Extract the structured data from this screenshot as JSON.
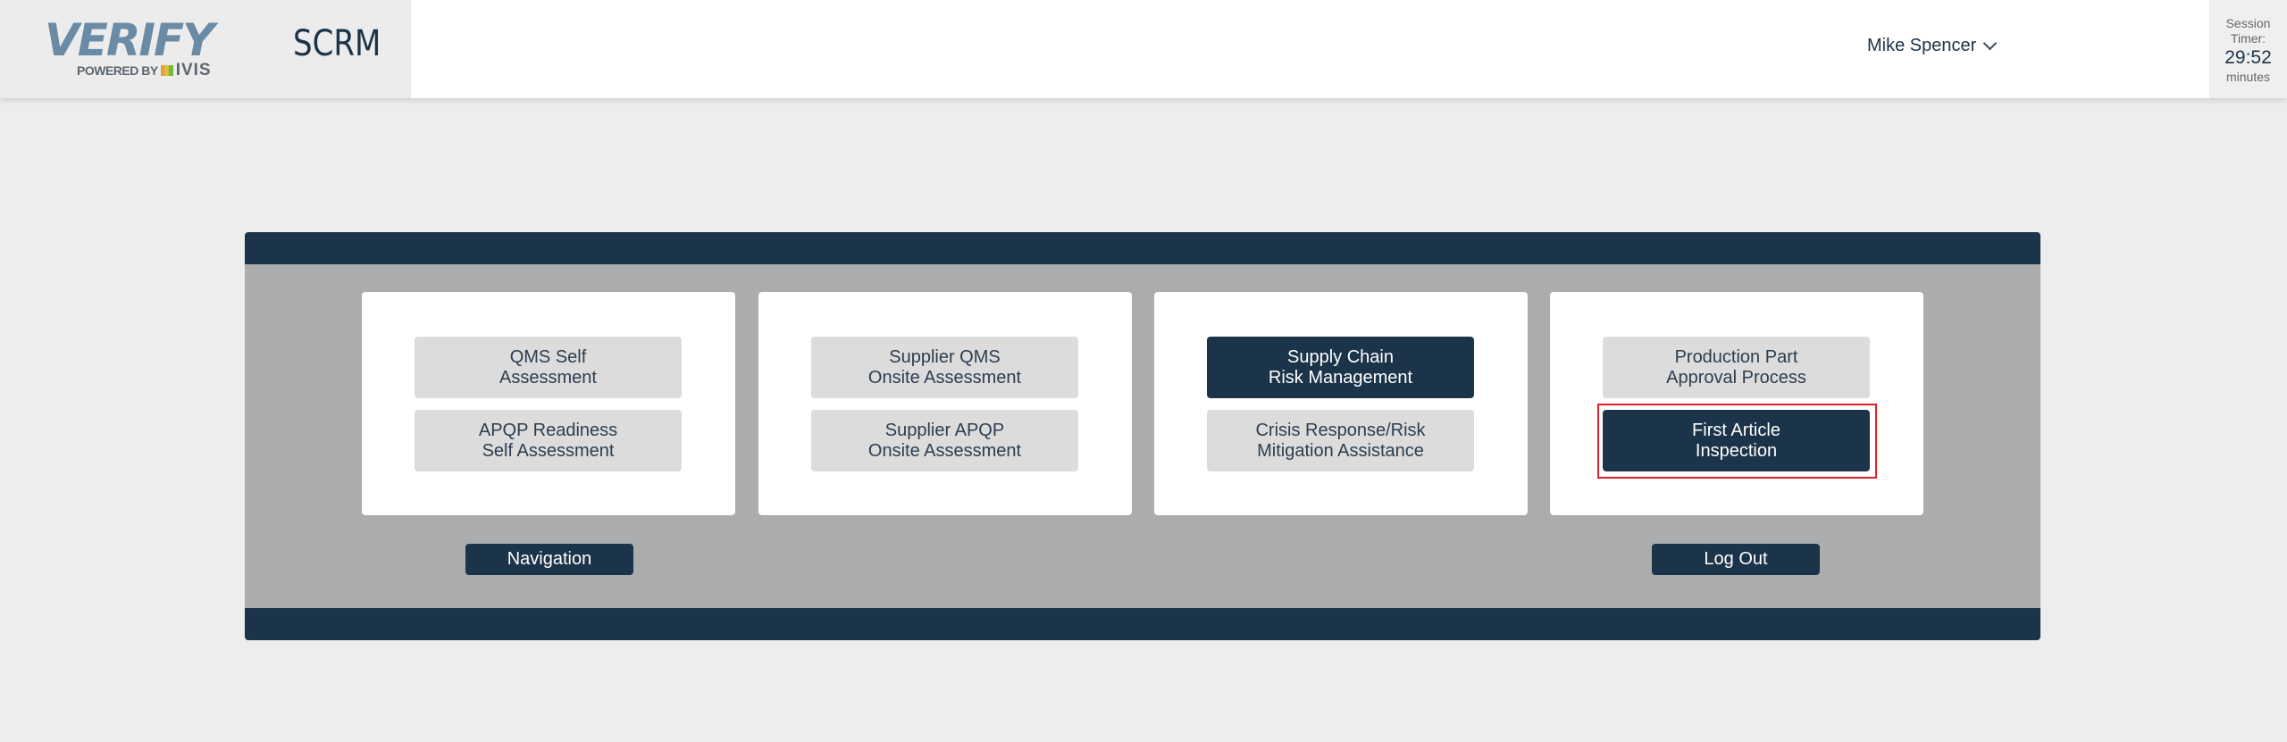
{
  "header": {
    "logo_text": "VERIFY",
    "logo_subtext": "POWERED BY",
    "logo_brand": "IVIS",
    "app_name": "SCRM",
    "user_name": "Mike Spencer",
    "session_timer": {
      "label_line1": "Session",
      "label_line2": "Timer:",
      "value": "29:52",
      "unit": "minutes"
    }
  },
  "cards": [
    {
      "buttons": [
        {
          "label": "QMS Self\nAssessment",
          "active": false
        },
        {
          "label": "APQP Readiness\nSelf Assessment",
          "active": false
        }
      ]
    },
    {
      "buttons": [
        {
          "label": "Supplier QMS\nOnsite Assessment",
          "active": false
        },
        {
          "label": "Supplier APQP\nOnsite Assessment",
          "active": false
        }
      ]
    },
    {
      "buttons": [
        {
          "label": "Supply Chain\nRisk Management",
          "active": true
        },
        {
          "label": "Crisis Response/Risk\nMitigation Assistance",
          "active": false
        }
      ]
    },
    {
      "buttons": [
        {
          "label": "Production Part\nApproval Process",
          "active": false
        },
        {
          "label": "First Article\nInspection",
          "active": true,
          "highlighted": true
        }
      ]
    }
  ],
  "footer_buttons": {
    "navigation": "Navigation",
    "logout": "Log Out"
  },
  "colors": {
    "primary": "#1b3449",
    "panel": "#abacad",
    "button_inactive": "#dcdcdc",
    "highlight": "#e0202a"
  }
}
